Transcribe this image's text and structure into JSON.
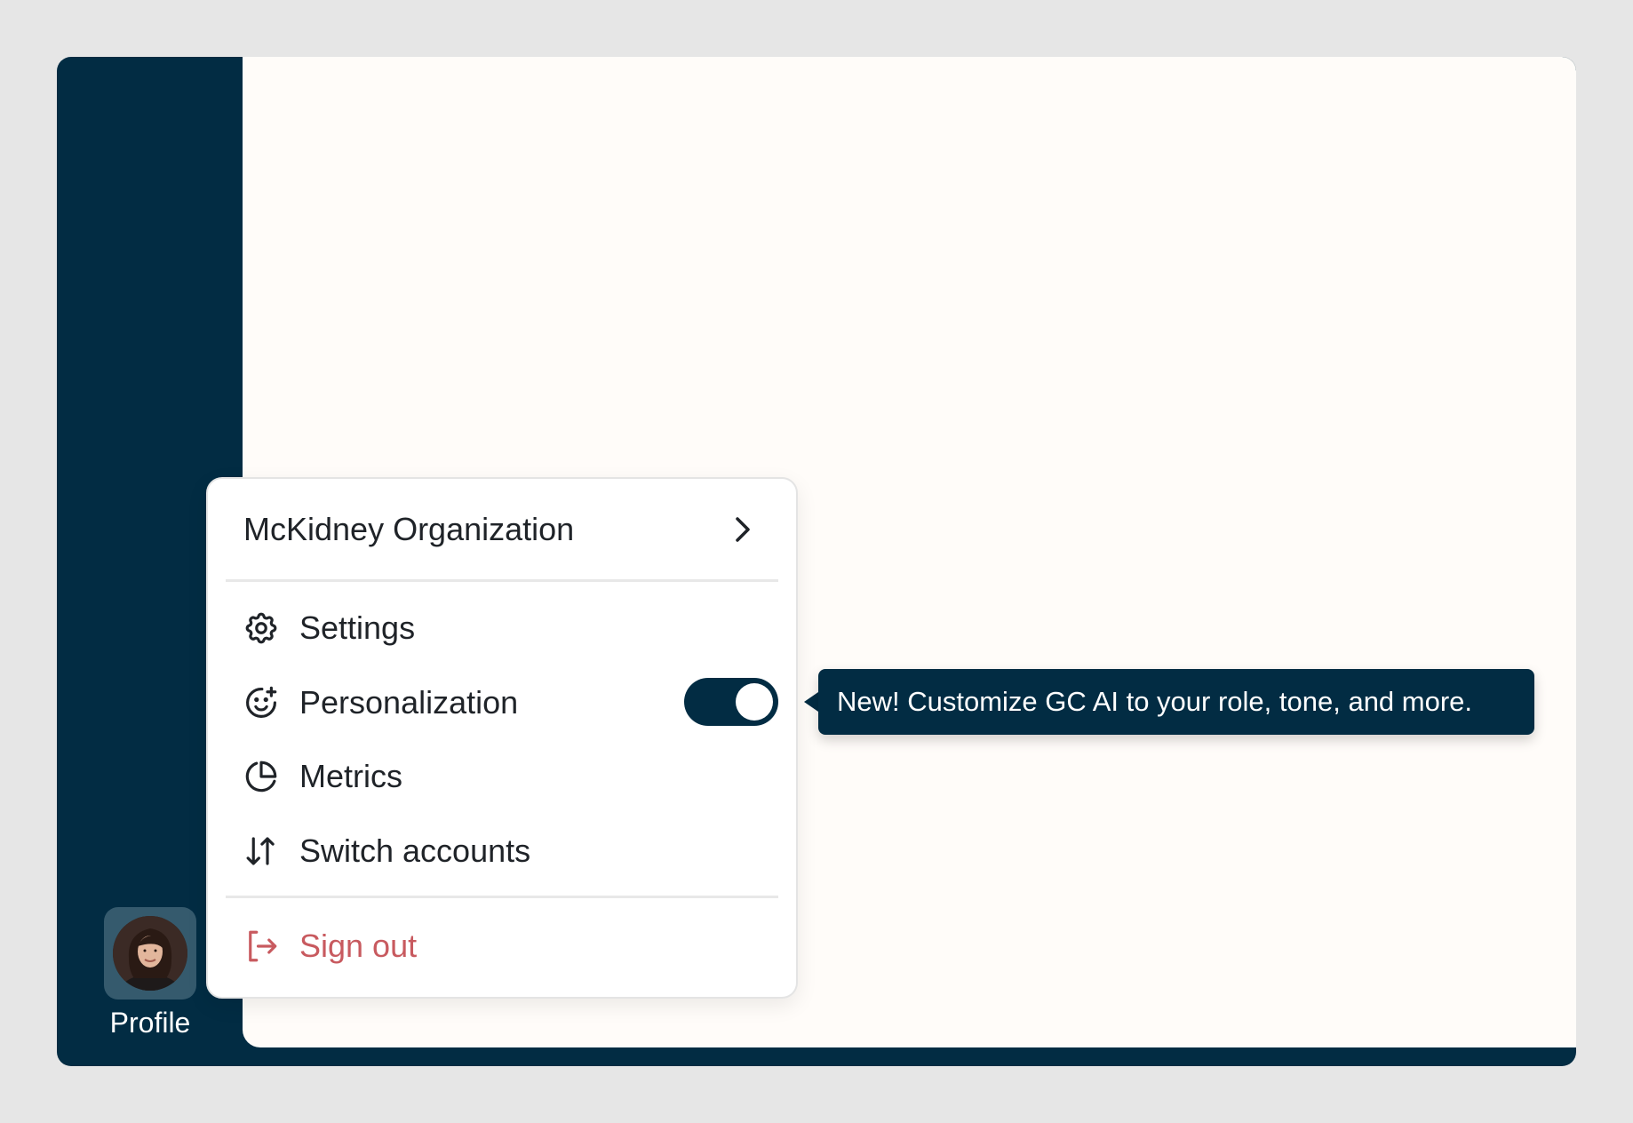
{
  "sidebar": {
    "profile_label": "Profile",
    "avatar_icon": "person-photo"
  },
  "menu": {
    "organization": "McKidney Organization",
    "items": [
      {
        "label": "Settings",
        "icon": "gear-icon"
      },
      {
        "label": "Personalization",
        "icon": "smiley-sparkle-icon",
        "toggle_on": true
      },
      {
        "label": "Metrics",
        "icon": "pie-chart-icon"
      },
      {
        "label": "Switch accounts",
        "icon": "arrows-up-down-icon"
      }
    ],
    "sign_out": "Sign out"
  },
  "tooltip": {
    "text": "New! Customize GC AI to your role, tone, and more."
  },
  "colors": {
    "sidebar": "#022c43",
    "content": "#fffcf9",
    "danger": "#c85a5f",
    "page_bg": "#e6e6e6"
  }
}
